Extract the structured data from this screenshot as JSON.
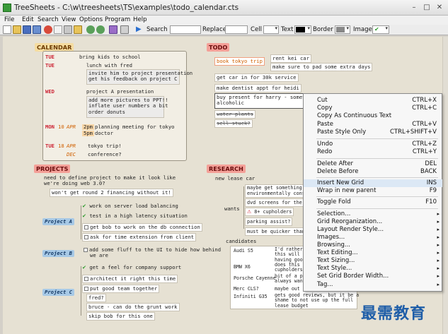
{
  "window": {
    "title": "TreeSheets - C:\\w\\treesheets\\TS\\examples\\todo_calendar.cts",
    "min_glyph": "–",
    "max_glyph": "□",
    "close_glyph": "✕"
  },
  "menu": [
    "File",
    "Edit",
    "Search",
    "View",
    "Options",
    "Program",
    "Help"
  ],
  "toolbar": {
    "search_label": "Search",
    "replace_label": "Replace",
    "cell_label": "Cell",
    "text_label": "Text",
    "border_label": "Border",
    "image_label": "Image",
    "play_glyph": "▶",
    "image_check": "✔",
    "text_color": "#000000",
    "border_color": "#888888",
    "icons": [
      "new-icon",
      "open-icon",
      "save-icon",
      "save-as-icon",
      "undo-icon",
      "copy-icon",
      "cut-icon",
      "paste-icon",
      "zoom-in-icon",
      "zoom-out-icon",
      "toggle-icon",
      "print-icon"
    ]
  },
  "calendar": {
    "header": "CALENDAR",
    "rows": [
      {
        "day": "TUE",
        "num": "",
        "month": "",
        "items": [
          "bring kids to school"
        ]
      },
      {
        "day": "TUE",
        "num": "",
        "month": "",
        "items": [
          "lunch with fred",
          "invite him to project presentation",
          "get his feedback on project C"
        ]
      },
      {
        "day": "WED",
        "num": "",
        "month": "",
        "items": [
          "project A presentation",
          "add more pictures to PPT!!",
          "inflate user numbers a bit",
          "order donuts"
        ]
      },
      {
        "day": "MON",
        "num": "10",
        "month": "APR",
        "items": [
          "2pm",
          "planning meeting for tokyo",
          "5pm",
          "doctor"
        ]
      },
      {
        "day": "TUE",
        "num": "18",
        "month": "APR",
        "items": [
          "tokyo trip!"
        ]
      },
      {
        "day": "",
        "num": "",
        "month": "DEC",
        "items": [
          "conference?"
        ]
      }
    ]
  },
  "todo": {
    "header": "TODO",
    "items": [
      "book tokyo trip",
      "rent kei car",
      "make sure to pad some extra days",
      "get car in for 30k service",
      "make dentist appt for heidi",
      "buy present for harry - someth",
      "alcoholic",
      "water plants",
      "sell stuck?"
    ]
  },
  "projects": {
    "header": "PROJECTS",
    "intro": [
      "need to define project to make it look like",
      "we're doing web 3.0?",
      "won't get round 2 financing without it!"
    ],
    "project_a": {
      "name": "Project A",
      "tasks": [
        "work on server load balancing",
        "test in a high latency situation",
        "get bob to work on the db connection",
        "ask for time extension from client"
      ]
    },
    "project_b": {
      "name": "Project B",
      "tasks": [
        "add some fluff to the UI to hide how behind",
        "we are"
      ]
    },
    "project_c": {
      "name": "Project C",
      "tasks": [
        "get a feel for company support",
        "architect it right this time",
        "put good team together",
        "fred?",
        "bruce - can do the grunt work",
        "skip bob for this one"
      ]
    },
    "check_glyph": "✔"
  },
  "research": {
    "header": "RESEARCH",
    "lease": "new lease car",
    "wants_label": "wants",
    "wants": [
      "maybe get something th",
      "environmentally consc",
      "dvd screens for the ki",
      "8+ cupholders",
      "parking assist?",
      "must be quicker than f"
    ],
    "candidates_label": "candidates",
    "candidates": [
      {
        "name": "Audi S5",
        "note": [
          "I'd rather",
          "this will m",
          "having good"
        ]
      },
      {
        "name": "BMW X6",
        "note": [
          "does this h",
          "cupholders?"
        ]
      },
      {
        "name": "Porsche Cayenne",
        "note": [
          "bit of a pa",
          "always want"
        ]
      },
      {
        "name": "Merc CLS?",
        "note": [
          "maybe out o"
        ]
      },
      {
        "name": "Infiniti G35",
        "note": [
          "gets good reviews, but it be a",
          "shame to not use up the full",
          "lease budget"
        ]
      }
    ]
  },
  "context_menu": {
    "items": [
      {
        "label": "Cut",
        "shortcut": "CTRL+X"
      },
      {
        "label": "Copy",
        "shortcut": "CTRL+C"
      },
      {
        "label": "Copy As Continuous Text",
        "shortcut": ""
      },
      {
        "label": "Paste",
        "shortcut": "CTRL+V"
      },
      {
        "label": "Paste Style Only",
        "shortcut": "CTRL+SHIFT+V"
      },
      {
        "label": "Undo",
        "shortcut": "CTRL+Z"
      },
      {
        "label": "Redo",
        "shortcut": "CTRL+Y"
      },
      {
        "label": "Delete After",
        "shortcut": "DEL"
      },
      {
        "label": "Delete Before",
        "shortcut": "BACK"
      },
      {
        "label": "Insert New Grid",
        "shortcut": "INS"
      },
      {
        "label": "Wrap in new parent",
        "shortcut": "F9"
      },
      {
        "label": "Toggle Fold",
        "shortcut": "F10"
      },
      {
        "label": "Selection...",
        "shortcut": ""
      },
      {
        "label": "Grid Reorganization...",
        "shortcut": ""
      },
      {
        "label": "Layout  Render Style...",
        "shortcut": ""
      },
      {
        "label": "Images...",
        "shortcut": ""
      },
      {
        "label": "Browsing...",
        "shortcut": ""
      },
      {
        "label": "Text Editing...",
        "shortcut": ""
      },
      {
        "label": "Text Sizing...",
        "shortcut": ""
      },
      {
        "label": "Text Style...",
        "shortcut": ""
      },
      {
        "label": "Set Grid Border Width...",
        "shortcut": ""
      },
      {
        "label": "Tag...",
        "shortcut": ""
      }
    ],
    "submenu_arrow": "▸"
  },
  "watermark": "最需教育"
}
